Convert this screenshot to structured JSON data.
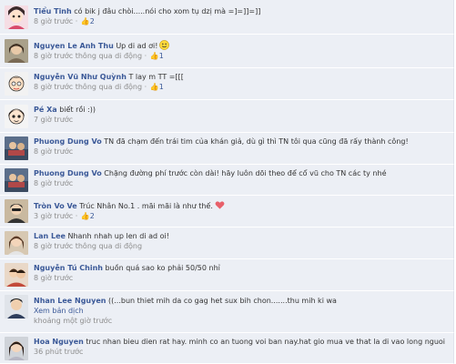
{
  "comments": [
    {
      "author": "Tiểu Tinh",
      "text": "có bik j đâu chòi.....nói cho xom tụ dzị mà =]=]]=]]",
      "time": "8 giờ trước",
      "via": "",
      "likes": "2"
    },
    {
      "author": "Nguyen Le Anh Thu",
      "text": "Up di ad ơi!",
      "emoji": "smile-icon",
      "time": "8 giờ trước",
      "via": "thông qua di động",
      "likes": "1"
    },
    {
      "author": "Nguyễn Vũ Như Quỳnh",
      "text": "T lay m TT =[[[",
      "time": "8 giờ trước",
      "via": "thông qua di động",
      "likes": "1"
    },
    {
      "author": "Pé Xa",
      "text": "biết rồi :))",
      "time": "7 giờ trước",
      "via": "",
      "likes": ""
    },
    {
      "author": "Phuong Dung Vo",
      "text": "TN đã chạm đến trái tim của khán giả, dù gì thì TN tôi qua cũng đã rấy thành công!",
      "time": "8 giờ trước",
      "via": "",
      "likes": ""
    },
    {
      "author": "Phuong Dung Vo",
      "text": "Chặng đường phí trước còn dài! hãy luôn dõi theo để cổ vũ cho TN các ty nhé",
      "time": "8 giờ trước",
      "via": "",
      "likes": ""
    },
    {
      "author": "Tròn Vo Ve",
      "text": "Trúc Nhân No.1 . mãi mãi là như thế.",
      "emoji": "heart-icon",
      "time": "3 giờ trước",
      "via": "",
      "likes": "2"
    },
    {
      "author": "Lan Lee",
      "text": "Nhanh nhah up len di ad oi!",
      "time": "8 giờ trước",
      "via": "thông qua di động",
      "likes": ""
    },
    {
      "author": "Nguyễn Tú Chinh",
      "text": "buồn quá sao ko phải 50/50 nhỉ",
      "time": "8 giờ trước",
      "via": "",
      "likes": ""
    },
    {
      "author": "Nhan Lee Nguyen",
      "text": "((...bun thiet mih da co gag het sux bih chon.......thu mih ki wa",
      "translate": "Xem bản dịch",
      "time": "khoảng một giờ trước",
      "via": "",
      "likes": ""
    },
    {
      "author": "Hoa Nguyen",
      "text": "truc nhan bieu dien rat hay. minh co an tuong voi ban nay.hat gio mua ve that la di vao long nguoi",
      "time": "36 phút trước",
      "via": "",
      "likes": ""
    }
  ],
  "colors": {
    "link": "#3b5998",
    "background": "#eceff5",
    "meta": "#8d8d8d"
  }
}
